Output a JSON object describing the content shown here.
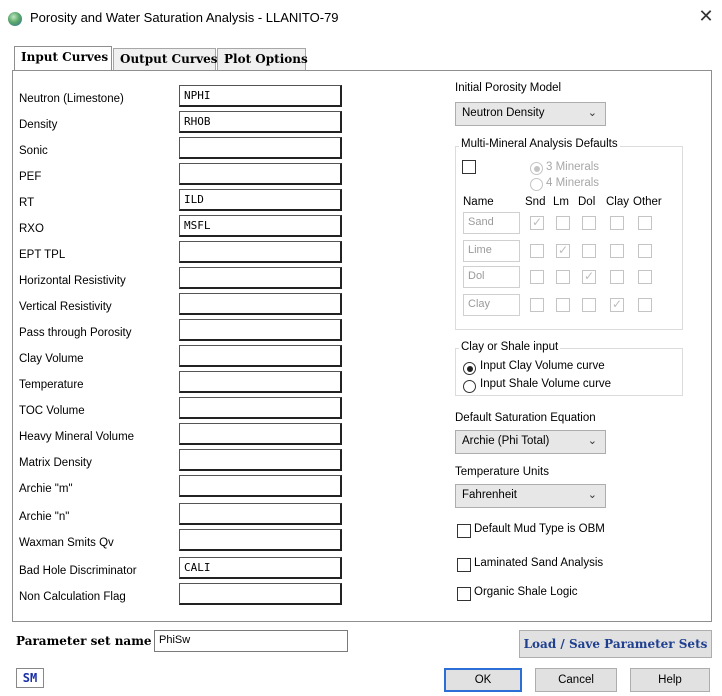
{
  "window": {
    "title": "Porosity and Water Saturation Analysis - LLANITO-79",
    "close_glyph": "✕",
    "icon": "app-globe-icon"
  },
  "tabs": [
    {
      "label": "Input Curves",
      "active": true
    },
    {
      "label": "Output Curves",
      "active": false
    },
    {
      "label": "Plot Options",
      "active": false
    }
  ],
  "input_curves": [
    {
      "label": "Neutron (Limestone)",
      "value": "NPHI"
    },
    {
      "label": "Density",
      "value": "RHOB"
    },
    {
      "label": "Sonic",
      "value": ""
    },
    {
      "label": "PEF",
      "value": ""
    },
    {
      "label": "RT",
      "value": "ILD"
    },
    {
      "label": "RXO",
      "value": "MSFL"
    },
    {
      "label": "EPT TPL",
      "value": ""
    },
    {
      "label": "Horizontal Resistivity",
      "value": ""
    },
    {
      "label": "Vertical Resistivity",
      "value": ""
    },
    {
      "label": "Pass through Porosity",
      "value": ""
    },
    {
      "label": "Clay Volume",
      "value": ""
    },
    {
      "label": "Temperature",
      "value": ""
    },
    {
      "label": "TOC Volume",
      "value": ""
    },
    {
      "label": "Heavy Mineral Volume",
      "value": ""
    },
    {
      "label": "Matrix Density",
      "value": ""
    },
    {
      "label": "Archie \"m\"",
      "value": ""
    },
    {
      "label": "Archie \"n\"",
      "value": ""
    },
    {
      "label": "Waxman Smits Qv",
      "value": ""
    },
    {
      "label": "Bad Hole Discriminator",
      "value": "CALI"
    },
    {
      "label": "Non Calculation Flag",
      "value": ""
    }
  ],
  "porosity_model": {
    "label": "Initial Porosity Model",
    "selected": "Neutron Density"
  },
  "multi_mineral": {
    "title": "Multi-Mineral Analysis Defaults",
    "enabled": false,
    "option_3": "3 Minerals",
    "option_4": "4 Minerals",
    "headers": [
      "Name",
      "Snd",
      "Lm",
      "Dol",
      "Clay",
      "Other"
    ],
    "rows": [
      {
        "name": "Sand",
        "checks": [
          true,
          false,
          false,
          false,
          false
        ]
      },
      {
        "name": "Lime",
        "checks": [
          false,
          true,
          false,
          false,
          false
        ]
      },
      {
        "name": "Dol",
        "checks": [
          false,
          false,
          true,
          false,
          false
        ]
      },
      {
        "name": "Clay",
        "checks": [
          false,
          false,
          false,
          true,
          false
        ]
      }
    ]
  },
  "clay_shale": {
    "title": "Clay or Shale input",
    "option_clay": "Input Clay Volume curve",
    "option_shale": "Input Shale Volume curve",
    "selected": "clay"
  },
  "saturation": {
    "label": "Default Saturation Equation",
    "selected": "Archie (Phi Total)"
  },
  "temperature_units": {
    "label": "Temperature Units",
    "selected": "Fahrenheit"
  },
  "options": [
    {
      "label": "Default Mud Type is OBM",
      "checked": false
    },
    {
      "label": "Laminated Sand Analysis",
      "checked": false
    },
    {
      "label": "Organic Shale Logic",
      "checked": false
    }
  ],
  "footer": {
    "param_label": "Parameter set name",
    "param_value": "PhiSw",
    "load_save": "Load / Save Parameter Sets",
    "logo_text": "SM",
    "ok": "OK",
    "cancel": "Cancel",
    "help": "Help"
  },
  "colors": {
    "accent": "#2b6fd6",
    "link_blue": "#1f3f8f",
    "logo_blue": "#1b2fa8"
  }
}
